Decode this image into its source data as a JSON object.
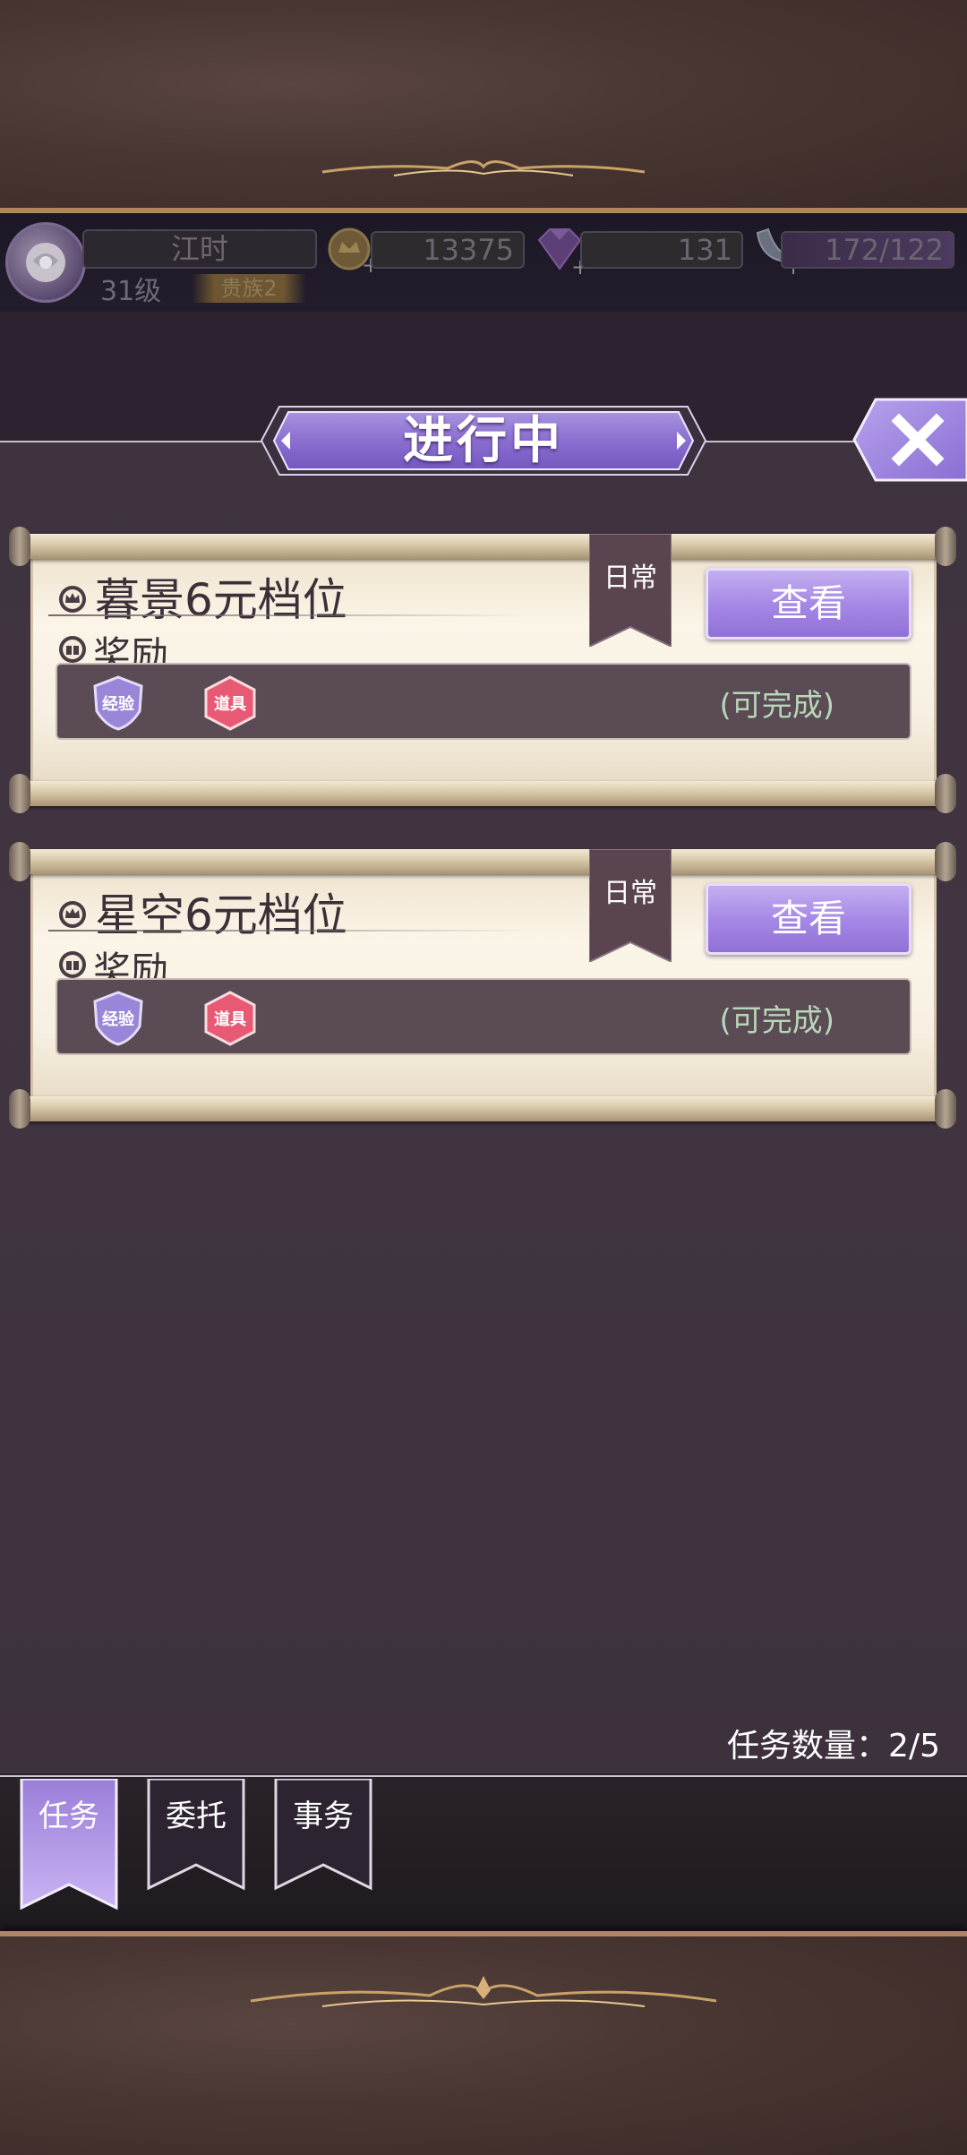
{
  "player": {
    "name": "江时",
    "level": "31级",
    "title": "贵族2"
  },
  "resources": {
    "gold": "13375",
    "gems": "131",
    "stamina": "172/122"
  },
  "panel": {
    "title": "进行中",
    "close_label": "X"
  },
  "tasks": [
    {
      "name": "暮景6元档位",
      "tag": "日常",
      "reward_label": "奖励",
      "button": "查看",
      "rewards": [
        "经验",
        "道具"
      ],
      "status": "(可完成)"
    },
    {
      "name": "星空6元档位",
      "tag": "日常",
      "reward_label": "奖励",
      "button": "查看",
      "rewards": [
        "经验",
        "道具"
      ],
      "status": "(可完成)"
    }
  ],
  "footer": {
    "task_count": "任务数量：2/5"
  },
  "tabs": [
    {
      "label": "任务",
      "active": true
    },
    {
      "label": "委托",
      "active": false
    },
    {
      "label": "事务",
      "active": false
    }
  ],
  "colors": {
    "accent_purple": "#a689e6",
    "scroll_paper": "#f7f0e2",
    "reward_exp": "#9a86d8",
    "reward_item": "#e85a74",
    "status_green": "#b8d6b8"
  }
}
